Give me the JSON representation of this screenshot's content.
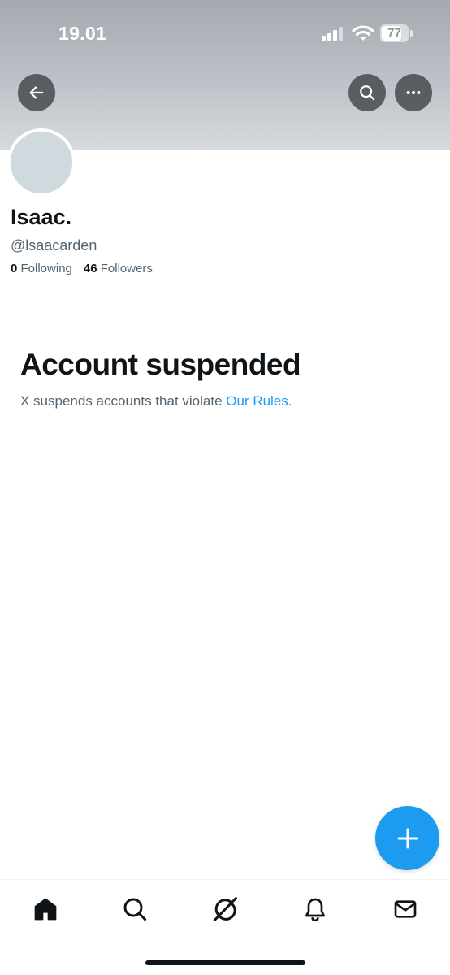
{
  "status_bar": {
    "time": "19.01",
    "battery": "77",
    "battery_level": 0.77
  },
  "header": {
    "back_icon": "arrow-left-icon",
    "search_icon": "search-icon",
    "more_icon": "more-horizontal-icon"
  },
  "profile": {
    "display_name": "Isaac.",
    "handle": "@lsaacarden",
    "following_count": "0",
    "following_label": "Following",
    "followers_count": "46",
    "followers_label": "Followers"
  },
  "suspension": {
    "title": "Account suspended",
    "description": "X suspends accounts that violate ",
    "link": "Our Rules",
    "suffix": "."
  },
  "fab": {
    "icon": "plus-icon"
  },
  "tabbar": {
    "items": [
      "home-icon",
      "search-icon",
      "grok-icon",
      "notifications-icon",
      "messages-icon"
    ]
  },
  "colors": {
    "accent": "#1d9bf0",
    "text": "#0f1419",
    "secondary": "#536471",
    "avatar": "#cfd9de"
  }
}
